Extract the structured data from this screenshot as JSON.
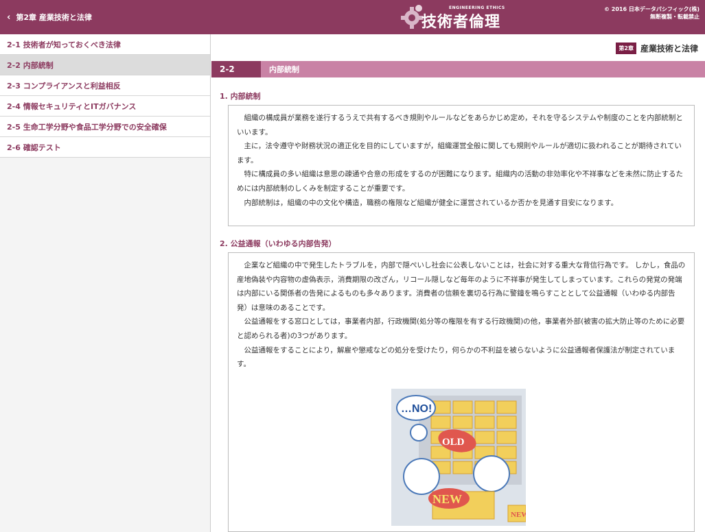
{
  "header": {
    "back_label": "第2章 産業技術と法律",
    "logo_sub": "ENGINEERING ETHICS",
    "logo_title": "技術者倫理",
    "copyright_line1": "© 2016 日本データパシフィック(株)",
    "copyright_line2": "無断複製・転載禁止"
  },
  "sidebar": {
    "items": [
      {
        "label": "2-1 技術者が知っておくべき法律"
      },
      {
        "label": "2-2 内部統制"
      },
      {
        "label": "2-3 コンプライアンスと利益相反"
      },
      {
        "label": "2-4 情報セキュリティとITガバナンス"
      },
      {
        "label": "2-5 生命工学分野や食品工学分野での安全確保"
      },
      {
        "label": "2-6 確認テスト"
      }
    ]
  },
  "main": {
    "chapter_badge": "第2章",
    "chapter_title": "産業技術と法律",
    "section_num": "2-2",
    "section_name": "内部統制",
    "sub1": {
      "heading": "1. 内部統制",
      "paragraphs": [
        "組織の構成員が業務を遂行するうえで共有するべき規則やルールなどをあらかじめ定め，それを守るシステムや制度のことを内部統制といいます。",
        "主に，法令遵守や財務状況の適正化を目的にしていますが，組織運営全般に関しても規則やルールが適切に扱われることが期待されています。",
        "特に構成員の多い組織は意思の疎通や合意の形成をするのが困難になります。組織内の活動の非効率化や不祥事などを未然に防止するためには内部統制のしくみを制定することが重要です。",
        "内部統制は，組織の中の文化や構造，職務の権限など組織が健全に運営されているか否かを見通す目安になります。"
      ]
    },
    "sub2": {
      "heading": "2. 公益通報（いわゆる内部告発）",
      "paragraphs": [
        "企業など組織の中で発生したトラブルを，内部で隠ぺいし社会に公表しないことは，社会に対する重大な背信行為です。 しかし，食品の産地偽装や内容物の虚偽表示，消費期限の改ざん，リコール隠しなど毎年のように不祥事が発生してしまっています。これらの発覚の発端は内部にいる関係者の告発によるものも多々あります。消費者の信頼を裏切る行為に警鐘を鳴らすこととして公益通報（いわゆる内部告発）は意味のあることです。",
        "公益通報をする窓口としては，事業者内部，行政機関(処分等の権限を有する行政機関)の他，事業者外部(被害の拡大防止等のために必要と認められる者)の3つがあります。",
        "公益通報をすることにより，解雇や懲戒などの処分を受けたり，何らかの不利益を被らないように公益通報者保護法が制定されています。"
      ]
    },
    "illustration": {
      "bubble_text": "…NO!",
      "old_label": "OLD",
      "new_label": "NEW",
      "box_label": "NEW"
    }
  },
  "colors": {
    "brand": "#8c3a5f",
    "section_bar": "#c982a5",
    "badge": "#7a1f45"
  }
}
